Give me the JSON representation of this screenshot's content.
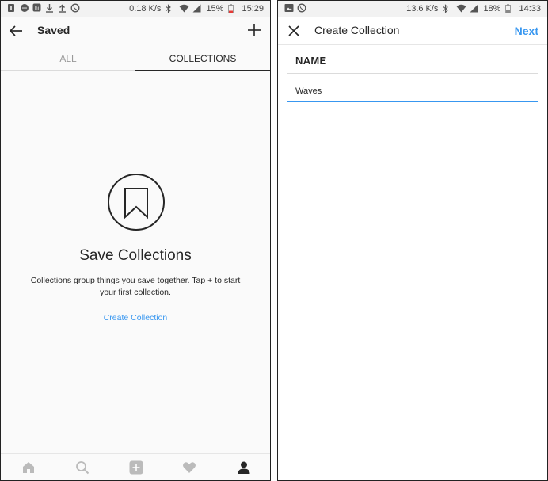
{
  "left_screen": {
    "status": {
      "speed": "0.18 K/s",
      "battery": "15%",
      "time": "15:29"
    },
    "header": {
      "title": "Saved"
    },
    "tabs": [
      {
        "label": "ALL"
      },
      {
        "label": "COLLECTIONS"
      }
    ],
    "selected_tab": "COLLECTIONS",
    "empty_state": {
      "title": "Save Collections",
      "description": "Collections group things you save together. Tap + to start your first collection.",
      "link": "Create Collection"
    },
    "bottom_nav": [
      "home-icon",
      "search-icon",
      "add-icon",
      "heart-icon",
      "profile-icon"
    ]
  },
  "right_screen": {
    "status": {
      "speed": "13.6 K/s",
      "battery": "18%",
      "time": "14:33"
    },
    "header": {
      "title": "Create Collection",
      "next_label": "Next"
    },
    "form": {
      "name_label": "NAME",
      "name_value": "Waves"
    }
  },
  "colors": {
    "accent": "#3897f0",
    "text": "#262626",
    "muted": "#999999",
    "battery_low": "#e53935"
  }
}
